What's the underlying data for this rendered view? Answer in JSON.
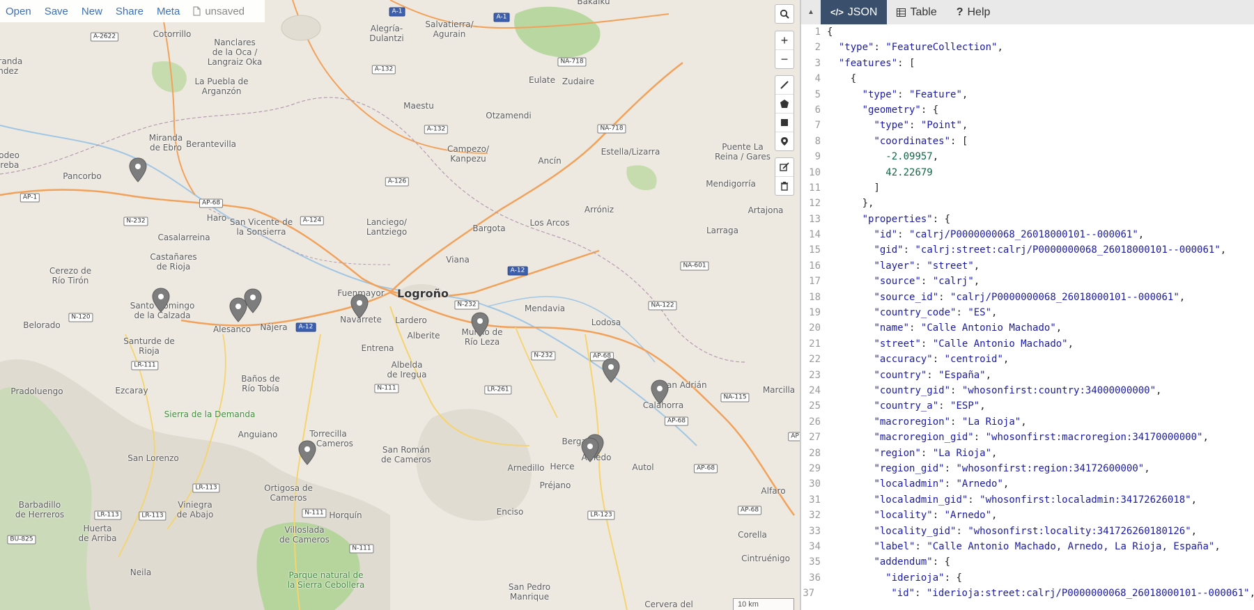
{
  "toolbar": {
    "open": "Open",
    "save": "Save",
    "new": "New",
    "share": "Share",
    "meta": "Meta",
    "file_status": "unsaved"
  },
  "map": {
    "places": [
      {
        "id": "cotorrillo",
        "text": "Cotorrillo"
      },
      {
        "id": "nanclares",
        "text": "Nanclares\nde la Oca /\nLangraiz Oka"
      },
      {
        "id": "alegria",
        "text": "Alegría-\nDulantzi"
      },
      {
        "id": "salvatierra",
        "text": "Salvatierra/\nAgurain"
      },
      {
        "id": "bakaiku",
        "text": "Bakaiku"
      },
      {
        "id": "eulate",
        "text": "Eulate"
      },
      {
        "id": "zudaire",
        "text": "Zudaire"
      },
      {
        "id": "puebla",
        "text": "La Puebla de\nArganzón"
      },
      {
        "id": "maestu",
        "text": "Maestu"
      },
      {
        "id": "otzamendi",
        "text": "Otzamendi"
      },
      {
        "id": "miranda",
        "text": "Miranda\nde Ebro"
      },
      {
        "id": "berantevilla",
        "text": "Berantevilla"
      },
      {
        "id": "campezo",
        "text": "Campezo/\nKanpezu"
      },
      {
        "id": "ancin",
        "text": "Ancín"
      },
      {
        "id": "estella",
        "text": "Estella/Lizarra"
      },
      {
        "id": "puente",
        "text": "Puente La\nReina / Gares"
      },
      {
        "id": "pancorbo",
        "text": "Pancorbo"
      },
      {
        "id": "mendigorria",
        "text": "Mendigorría"
      },
      {
        "id": "haro",
        "text": "Haro"
      },
      {
        "id": "sanvicente",
        "text": "San Vicente de\nla Sonsierra"
      },
      {
        "id": "lanciego",
        "text": "Lanciego/\nLantziego"
      },
      {
        "id": "artajona",
        "text": "Artajona"
      },
      {
        "id": "bargota",
        "text": "Bargota"
      },
      {
        "id": "losarcos",
        "text": "Los Arcos"
      },
      {
        "id": "arroniz",
        "text": "Arróniz"
      },
      {
        "id": "larraga",
        "text": "Larraga"
      },
      {
        "id": "casalarreina",
        "text": "Casalarreina"
      },
      {
        "id": "castanares",
        "text": "Castañares\nde Rioja"
      },
      {
        "id": "viana",
        "text": "Viana"
      },
      {
        "id": "cerezo",
        "text": "Cerezo de\nRío Tirón"
      },
      {
        "id": "fuenmayor",
        "text": "Fuenmayor"
      },
      {
        "id": "logrono",
        "text": "Logroño",
        "big": true
      },
      {
        "id": "santodomingo",
        "text": "Santo Domingo\nde la Calzada"
      },
      {
        "id": "mendavia",
        "text": "Mendavia"
      },
      {
        "id": "belorado",
        "text": "Belorado"
      },
      {
        "id": "alesanco",
        "text": "Alesanco"
      },
      {
        "id": "najera",
        "text": "Nájera"
      },
      {
        "id": "navarrete",
        "text": "Navarrete"
      },
      {
        "id": "lardero",
        "text": "Lardero"
      },
      {
        "id": "lodosa",
        "text": "Lodosa"
      },
      {
        "id": "murillo",
        "text": "Murillo de\nRío Leza"
      },
      {
        "id": "alberite",
        "text": "Alberite"
      },
      {
        "id": "santurde",
        "text": "Santurde de\nRioja"
      },
      {
        "id": "entrena",
        "text": "Entrena"
      },
      {
        "id": "albelda",
        "text": "Albelda\nde Iregua"
      },
      {
        "id": "sanadrian",
        "text": "San Adrián"
      },
      {
        "id": "banos",
        "text": "Baños de\nRío Tobía"
      },
      {
        "id": "marcilla",
        "text": "Marcilla"
      },
      {
        "id": "pradoluengo",
        "text": "Pradoluengo"
      },
      {
        "id": "ezcaray",
        "text": "Ezcaray"
      },
      {
        "id": "calahorra",
        "text": "Calahorra"
      },
      {
        "id": "sierra",
        "text": "Sierra de la Demanda",
        "green": true
      },
      {
        "id": "torrecilla",
        "text": "Torrecilla\nen Cameros"
      },
      {
        "id": "anguiano",
        "text": "Anguiano"
      },
      {
        "id": "sanroman",
        "text": "San Román\nde Cameros"
      },
      {
        "id": "bergasa",
        "text": "Bergasa"
      },
      {
        "id": "arnedo",
        "text": "Arnedo"
      },
      {
        "id": "sanlorenzo",
        "text": "San Lorenzo"
      },
      {
        "id": "arnedillo",
        "text": "Arnedillo"
      },
      {
        "id": "herce",
        "text": "Herce"
      },
      {
        "id": "autol",
        "text": "Autol"
      },
      {
        "id": "ortigosa",
        "text": "Ortigosa de\nCameros"
      },
      {
        "id": "prejano",
        "text": "Préjano"
      },
      {
        "id": "alfaro",
        "text": "Alfaro"
      },
      {
        "id": "barbadillo",
        "text": "Barbadillo\nde Herreros"
      },
      {
        "id": "viniegra",
        "text": "Viniegra\nde Abajo"
      },
      {
        "id": "horquin",
        "text": "Horquín"
      },
      {
        "id": "huerta",
        "text": "Huerta\nde Arriba"
      },
      {
        "id": "villoslada",
        "text": "Villoslada\nde Cameros"
      },
      {
        "id": "enciso",
        "text": "Enciso"
      },
      {
        "id": "corella",
        "text": "Corella"
      },
      {
        "id": "cintruenigo",
        "text": "Cintruénigo"
      },
      {
        "id": "parque",
        "text": "Parque natural de\nla Sierra Cebollera",
        "green": true
      },
      {
        "id": "neila",
        "text": "Neila"
      },
      {
        "id": "sanpedro",
        "text": "San Pedro\nManrique"
      },
      {
        "id": "cervera",
        "text": "Cervera del"
      },
      {
        "id": "andez",
        "text": "Miranda\nandez"
      },
      {
        "id": "sodeo",
        "text": "sodeo\nureba"
      }
    ],
    "shields": [
      {
        "id": "a2622",
        "text": "A-2622"
      },
      {
        "id": "a1a",
        "text": "A-1",
        "blue": true
      },
      {
        "id": "a1b",
        "text": "A-1",
        "blue": true
      },
      {
        "id": "a132a",
        "text": "A-132"
      },
      {
        "id": "na718a",
        "text": "NA-718"
      },
      {
        "id": "a132b",
        "text": "A-132"
      },
      {
        "id": "na718b",
        "text": "NA-718"
      },
      {
        "id": "ap1",
        "text": "AP-1"
      },
      {
        "id": "ap68a",
        "text": "AP-68"
      },
      {
        "id": "a126",
        "text": "A-126"
      },
      {
        "id": "n232a",
        "text": "N-232"
      },
      {
        "id": "a124",
        "text": "A-124"
      },
      {
        "id": "a12a",
        "text": "A-12",
        "blue": true
      },
      {
        "id": "na601",
        "text": "NA-601"
      },
      {
        "id": "n120",
        "text": "N-120"
      },
      {
        "id": "a12b",
        "text": "A-12",
        "blue": true
      },
      {
        "id": "n232b",
        "text": "N-232"
      },
      {
        "id": "na122",
        "text": "NA-122"
      },
      {
        "id": "n232c",
        "text": "N-232"
      },
      {
        "id": "ap68b",
        "text": "AP-68"
      },
      {
        "id": "lr111a",
        "text": "LR-111"
      },
      {
        "id": "n111a",
        "text": "N-111"
      },
      {
        "id": "lr261",
        "text": "LR-261"
      },
      {
        "id": "na115",
        "text": "NA-115"
      },
      {
        "id": "ap68c",
        "text": "AP-68"
      },
      {
        "id": "lr113a",
        "text": "LR-113"
      },
      {
        "id": "lr113b",
        "text": "LR-113"
      },
      {
        "id": "lr113c",
        "text": "LR-113"
      },
      {
        "id": "n111b",
        "text": "N-111"
      },
      {
        "id": "lr123",
        "text": "LR-123"
      },
      {
        "id": "ap68d",
        "text": "AP-68"
      },
      {
        "id": "ap68e",
        "text": "AP-68"
      },
      {
        "id": "bu825",
        "text": "BU-825"
      },
      {
        "id": "n111c",
        "text": "N-111"
      },
      {
        "id": "ap2",
        "text": "AP"
      }
    ],
    "scale_label": "10 km"
  },
  "panel": {
    "tabs": [
      {
        "label": "JSON",
        "icon": "code-icon"
      },
      {
        "label": "Table",
        "icon": "table-icon"
      },
      {
        "label": "Help",
        "icon": "help-icon"
      }
    ],
    "lines": [
      "{",
      "  \"type\": \"FeatureCollection\",",
      "  \"features\": [",
      "    {",
      "      \"type\": \"Feature\",",
      "      \"geometry\": {",
      "        \"type\": \"Point\",",
      "        \"coordinates\": [",
      "          -2.09957,",
      "          42.22679",
      "        ]",
      "      },",
      "      \"properties\": {",
      "        \"id\": \"calrj/P0000000068_26018000101--000061\",",
      "        \"gid\": \"calrj:street:calrj/P0000000068_26018000101--000061\",",
      "        \"layer\": \"street\",",
      "        \"source\": \"calrj\",",
      "        \"source_id\": \"calrj/P0000000068_26018000101--000061\",",
      "        \"country_code\": \"ES\",",
      "        \"name\": \"Calle Antonio Machado\",",
      "        \"street\": \"Calle Antonio Machado\",",
      "        \"accuracy\": \"centroid\",",
      "        \"country\": \"España\",",
      "        \"country_gid\": \"whosonfirst:country:34000000000\",",
      "        \"country_a\": \"ESP\",",
      "        \"macroregion\": \"La Rioja\",",
      "        \"macroregion_gid\": \"whosonfirst:macroregion:34170000000\",",
      "        \"region\": \"La Rioja\",",
      "        \"region_gid\": \"whosonfirst:region:34172600000\",",
      "        \"localadmin\": \"Arnedo\",",
      "        \"localadmin_gid\": \"whosonfirst:localadmin:34172626018\",",
      "        \"locality\": \"Arnedo\",",
      "        \"locality_gid\": \"whosonfirst:locality:341726260180126\",",
      "        \"label\": \"Calle Antonio Machado, Arnedo, La Rioja, España\",",
      "        \"addendum\": {",
      "          \"iderioja\": {",
      "            \"id\": \"iderioja:street:calrj/P0000000068_26018000101--000061\","
    ]
  }
}
